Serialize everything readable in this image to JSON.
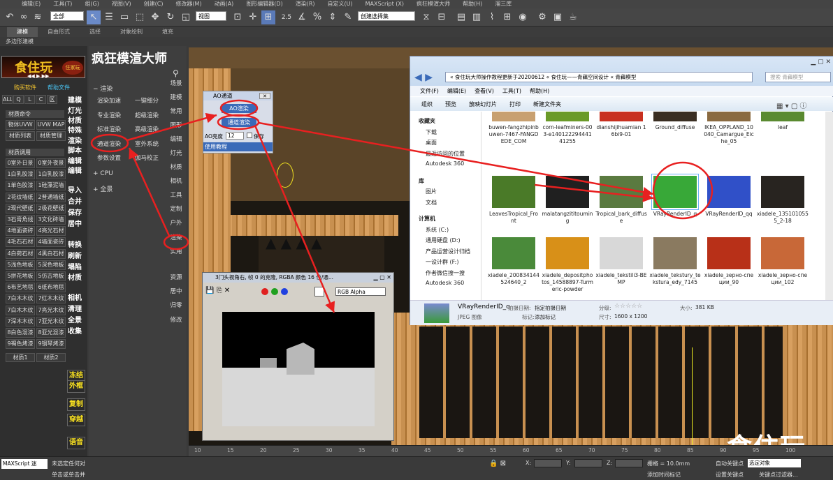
{
  "menubar": {
    "items": [
      "编辑(E)",
      "工具(T)",
      "组(G)",
      "视图(V)",
      "创建(C)",
      "修改器(M)",
      "动画(A)",
      "图形编辑器(D)",
      "渲染(R)",
      "自定义(U)",
      "MAXScript (X)",
      "疯狂模渲大师",
      "帮助(H)",
      "溜三库"
    ]
  },
  "toolbar": {
    "filter_value": "全部",
    "view_value": "视图",
    "selection_set_value": "创建选择集"
  },
  "ribbon": {
    "tabs": [
      "建模",
      "自由形式",
      "选择",
      "对象绘制",
      "填充"
    ],
    "active_index": 0,
    "sub_label": "多边形建模"
  },
  "left_panel": {
    "logo_text": "食住玩",
    "logo_badge": "住家玩",
    "links": [
      "购买软件",
      "帮助文件"
    ],
    "small_buttons": [
      "ALL",
      "Q",
      "L",
      "C",
      "区"
    ],
    "vert_buttons": [
      "建模",
      "灯光",
      "材质",
      "特殊",
      "渲染",
      "脚本",
      "编辑",
      "编辑",
      "导入",
      "合并",
      "保存",
      "居中",
      "转换",
      "刷新",
      "塌陷",
      "材质",
      "相机",
      "清理",
      "全景",
      "收集",
      "冻结",
      "外框",
      "复制",
      "穿越",
      "语音"
    ],
    "section1_title": "材质命令",
    "section1_buttons": [
      "物体UVW",
      "UVW MAP",
      "材质列表",
      "材质管理"
    ],
    "section2_title": "材质调用",
    "materials": [
      [
        "0室外日景",
        "0室外夜景"
      ],
      [
        "1白乳胶漆",
        "1白乳胶漆"
      ],
      [
        "1单色胶漆",
        "1硅藻泥墙"
      ],
      [
        "2花纹墙纸",
        "2普通墙纸"
      ],
      [
        "2现代壁纸",
        "2极花壁纸"
      ],
      [
        "3石膏角线",
        "3文化砖墙"
      ],
      [
        "4地面瓷砖",
        "4亮光石材"
      ],
      [
        "4毛石石材",
        "4墙面瓷砖"
      ],
      [
        "4白荷石材",
        "4黑白石材"
      ],
      [
        "5浅色地板",
        "5深色地板"
      ],
      [
        "5拼花地板",
        "5仿古地板"
      ],
      [
        "6布艺地毯",
        "6纸布地毯"
      ],
      [
        "7白木木纹",
        "7红木木纹"
      ],
      [
        "7白木木纹",
        "7亮光木纹"
      ],
      [
        "7深木木纹",
        "7亚光木纹"
      ],
      [
        "8白色混漆",
        "8亚光混漆"
      ],
      [
        "9褐色烤漆",
        "9钢琴烤漆"
      ]
    ],
    "material_tabs": [
      "材质1",
      "材质2"
    ]
  },
  "mid_panel": {
    "title": "疯狂模渲大师",
    "render_section": "渲染",
    "buttons": [
      [
        "渲染加速",
        "一键细分"
      ],
      [
        "专业渲染",
        "超级渲染"
      ],
      [
        "标准渲染",
        "高级渲染"
      ],
      [
        "通道渲染",
        "室外系统"
      ],
      [
        "参数设置",
        "伽马校正"
      ]
    ],
    "cpu_label": "CPU",
    "panorama_label": "全景",
    "right_col": [
      "场景",
      "建模",
      "常用",
      "图形",
      "编辑",
      "灯光",
      "材质",
      "相机",
      "工具",
      "定制",
      "户外",
      "渲染",
      "实用",
      "资源",
      "居中",
      "归零",
      "修改"
    ]
  },
  "ao_dialog": {
    "title": "AO通道",
    "btn_ao": "AO渲染",
    "btn_channel": "通道渲染",
    "brightness_label": "AO亮度",
    "brightness_value": "12",
    "save_label": "保存",
    "tutorial_label": "使用教程"
  },
  "frame_buffer": {
    "title": "3门头视角右, 帧 0 的克隆, RGBA 颜色 16 位/通...",
    "channel_value": "RGB Alpha"
  },
  "explorer": {
    "breadcrumb": [
      "食住玩大师操作教程更新于20200612",
      "食住玩——青藕空间设计",
      "青藕模型"
    ],
    "search_placeholder": "搜索 青藕模型",
    "menus": [
      "文件(F)",
      "编辑(E)",
      "查看(V)",
      "工具(T)",
      "帮助(H)"
    ],
    "tools": [
      "组织",
      "预览",
      "放映幻灯片",
      "打印",
      "新建文件夹"
    ],
    "nav": [
      {
        "label": "收藏夹",
        "group": true
      },
      {
        "label": "下载"
      },
      {
        "label": "桌面"
      },
      {
        "label": "最近访问的位置"
      },
      {
        "label": "Autodesk 360"
      },
      {
        "label": "库",
        "group": true
      },
      {
        "label": "图片"
      },
      {
        "label": "文档"
      },
      {
        "label": "计算机",
        "group": true
      },
      {
        "label": "系统 (C:)"
      },
      {
        "label": "通用硬盘 (D:)"
      },
      {
        "label": "产品运营设计归档"
      },
      {
        "label": "一设计群 (F:)"
      },
      {
        "label": "作者微信搜一搜"
      },
      {
        "label": "Autodesk 360"
      }
    ],
    "files": [
      {
        "name": "buwen-fangzhipinbuwen-7467-FANGDEDE_COM",
        "color": "#c8a070"
      },
      {
        "name": "corn-leafminers-003-e14012229444141255",
        "color": "#6a9a28"
      },
      {
        "name": "dianshijihuamian 16bi9-01",
        "color": "#c83020"
      },
      {
        "name": "Ground_diffuse",
        "color": "#3a2e22"
      },
      {
        "name": "IKEA_OPPLAND_10040_Camargue_Eiche_05",
        "color": "#8a6a40"
      },
      {
        "name": "leaf",
        "color": "#5a8a30"
      },
      {
        "name": "LeavesTropical_Front",
        "color": "#4a7a28"
      },
      {
        "name": "malatangzititouming",
        "color": "#202020"
      },
      {
        "name": "Tropical_bark_diffuse",
        "color": "#5a7a40"
      },
      {
        "name": "VRayRenderID_q",
        "color": "#38a838"
      },
      {
        "name": "VRayRenderID_qq",
        "color": "#3050c8"
      },
      {
        "name": "xiadele_1351010555_2-18",
        "color": "#282420"
      },
      {
        "name": "xiadele_200834144524640_2",
        "color": "#4a8a3a"
      },
      {
        "name": "xiadele_depositphotos_14588897-Turmeric-powder",
        "color": "#d89018"
      },
      {
        "name": "xiadele_tekstili3-BEMP",
        "color": "#d8d8d8"
      },
      {
        "name": "xiadele_tekstury_tekstura_edy_7145",
        "color": "#8a7a60"
      },
      {
        "name": "xiadele_зерно-специи_90",
        "color": "#b83018"
      },
      {
        "name": "xiadele_зерно-специи_102",
        "color": "#c86838"
      }
    ],
    "details": {
      "name": "VRayRenderID_q",
      "type": "JPEG 图像",
      "shot_date_label": "拍摄日期:",
      "shot_date_value": "指定拍摄日期",
      "tags_label": "标记:",
      "tags_value": "添加标记",
      "rating_label": "分级:",
      "dims_label": "尺寸:",
      "dims_value": "1600 x 1200",
      "size_label": "大小:",
      "size_value": "381 KB"
    }
  },
  "timeline": {
    "ticks": [
      "10",
      "15",
      "20",
      "25",
      "30",
      "35",
      "40",
      "45",
      "50",
      "55",
      "60",
      "65",
      "70",
      "75",
      "80",
      "85",
      "90",
      "95",
      "100"
    ]
  },
  "status": {
    "script_label": "MAXScript 迷",
    "msg1": "未选定任何对",
    "msg2": "单击或单击并",
    "x_label": "X:",
    "y_label": "Y:",
    "z_label": "Z:",
    "grid_label": "栅格 = 10.0mm",
    "autokey": "自动关键点",
    "selected": "选定对象",
    "setkey": "设置关键点",
    "keyfilter": "关键点过滤器...",
    "add_time_tag": "添加时间标记"
  },
  "watermark": "食住玩"
}
